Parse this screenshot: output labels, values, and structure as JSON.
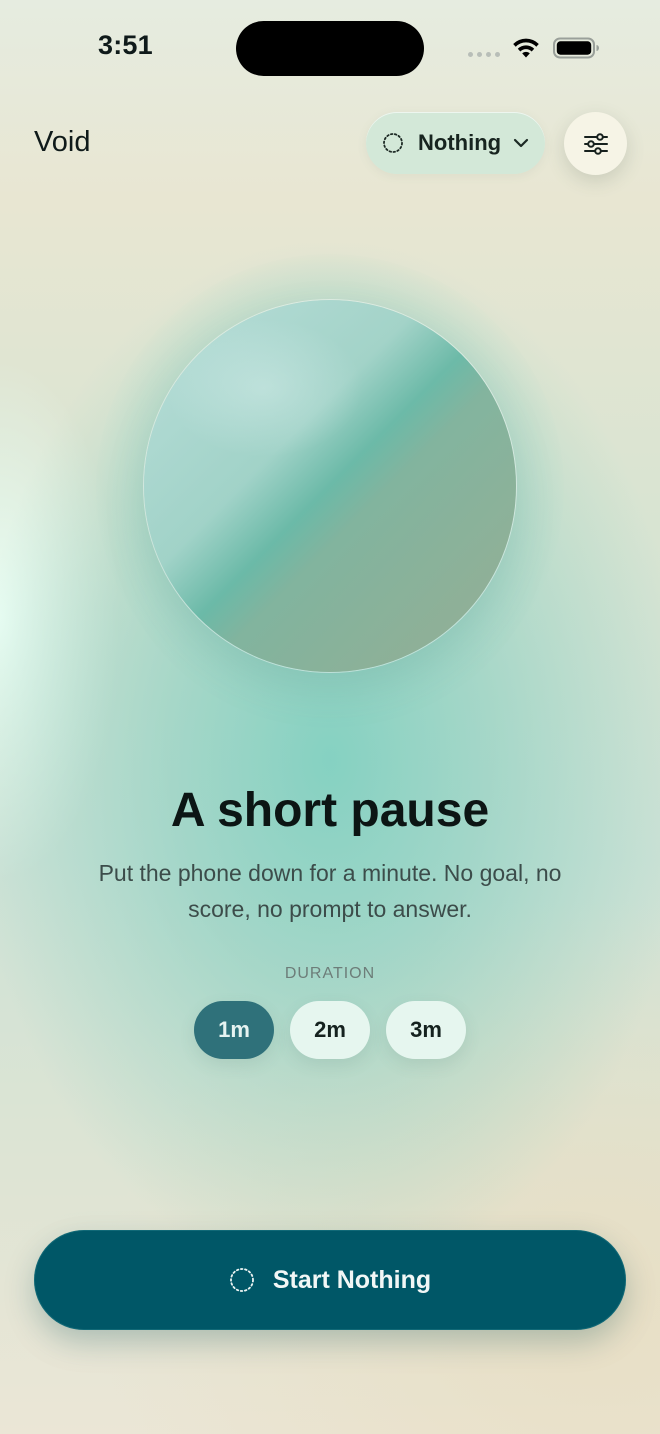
{
  "status_bar": {
    "time": "3:51"
  },
  "header": {
    "app_title": "Void",
    "mode_selector": {
      "label": "Nothing",
      "icon": "dotted-circle-icon"
    },
    "settings_icon": "sliders-icon"
  },
  "main": {
    "headline": "A short pause",
    "description": "Put the phone down for a minute. No goal, no score, no prompt to answer.",
    "duration": {
      "label": "DURATION",
      "options": [
        "1m",
        "2m",
        "3m"
      ],
      "selected": "1m"
    }
  },
  "start_button": {
    "label": "Start Nothing",
    "icon": "dotted-circle-icon"
  },
  "colors": {
    "accent": "#005767",
    "selected_chip": "#2f717a",
    "chip": "#e6f6ef",
    "mode_pill": "#cfe8d8",
    "settings_button": "#f6f4e6"
  }
}
